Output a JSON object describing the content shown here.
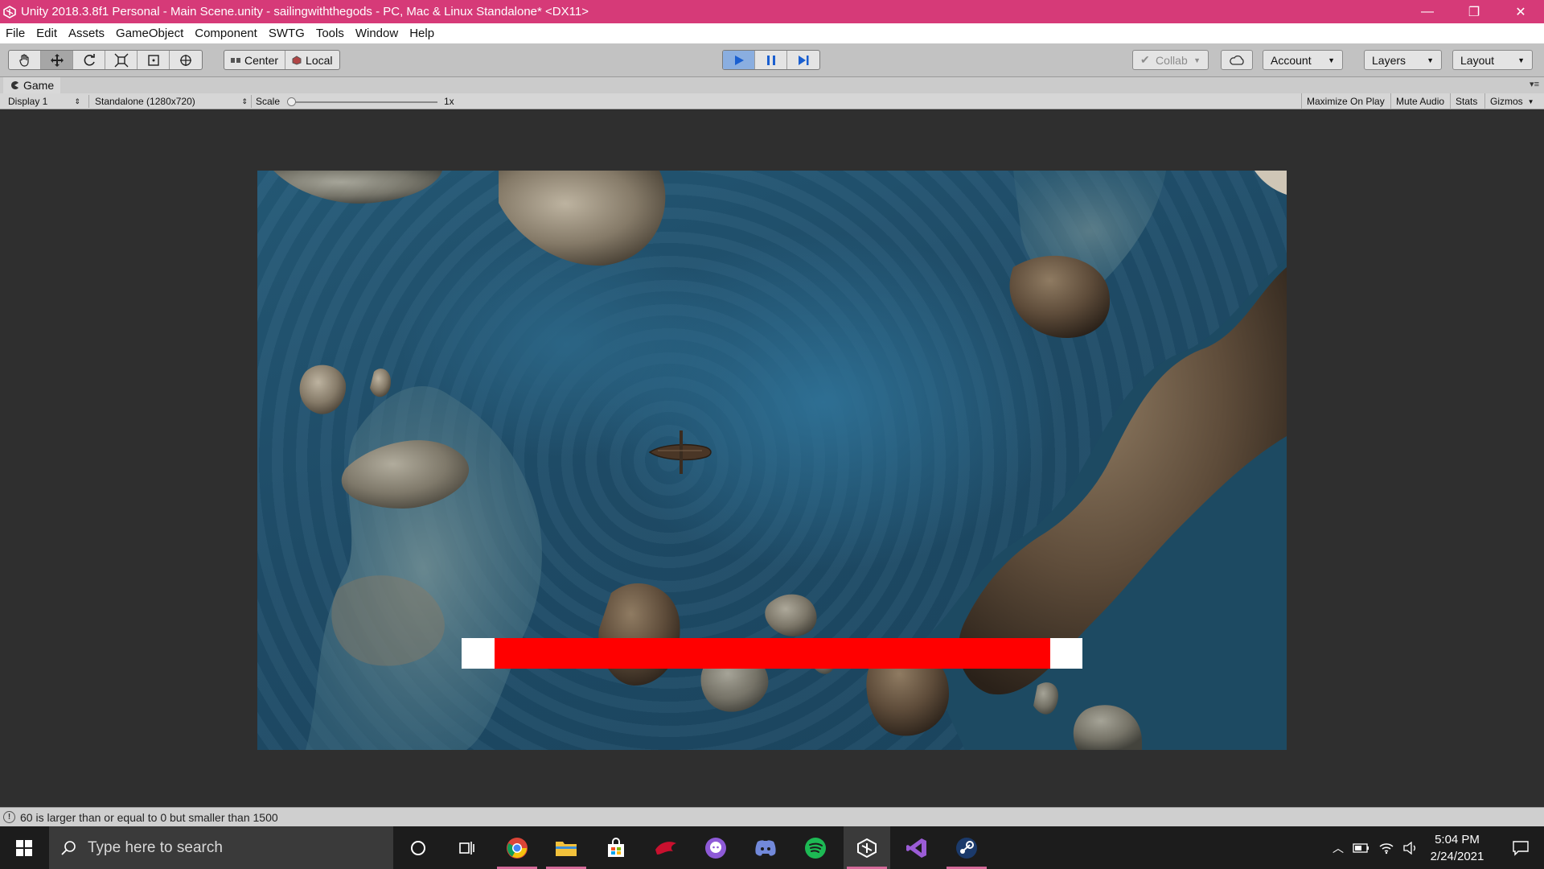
{
  "window": {
    "title": "Unity 2018.3.8f1 Personal - Main Scene.unity - sailingwiththegods - PC, Mac & Linux Standalone* <DX11>",
    "minimize": "—",
    "restore": "❐",
    "close": "✕"
  },
  "menu": [
    "File",
    "Edit",
    "Assets",
    "GameObject",
    "Component",
    "SWTG",
    "Tools",
    "Window",
    "Help"
  ],
  "toolbar": {
    "pivot_label": "Center",
    "space_label": "Local",
    "collab_label": "Collab",
    "account_label": "Account",
    "layers_label": "Layers",
    "layout_label": "Layout"
  },
  "tab": {
    "label": "Game"
  },
  "gamebar": {
    "display": "Display 1",
    "resolution": "Standalone (1280x720)",
    "scale_label": "Scale",
    "scale_value": "1x",
    "maximize": "Maximize On Play",
    "mute": "Mute Audio",
    "stats": "Stats",
    "gizmos": "Gizmos"
  },
  "hud": {
    "health_fraction": 0.895
  },
  "status": {
    "message": "60 is larger than or equal to 0 but smaller than 1500"
  },
  "taskbar": {
    "search_placeholder": "Type here to search",
    "time": "5:04 PM",
    "date": "2/24/2021"
  },
  "colors": {
    "titlebar": "#d63a78",
    "health_fill": "#ff0000",
    "health_bg": "#ffffff"
  }
}
